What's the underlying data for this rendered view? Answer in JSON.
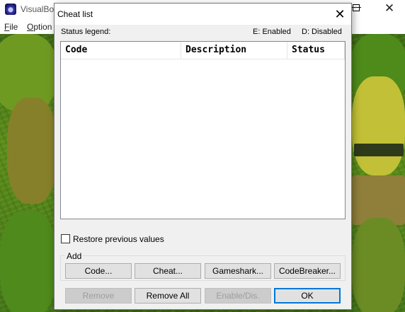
{
  "background_window": {
    "title": "VisualBo",
    "menu": [
      {
        "first": "F",
        "rest": "ile"
      },
      {
        "first": "O",
        "rest": "ption"
      }
    ],
    "minimize_glyph": "—",
    "close_glyph": "✕"
  },
  "dialog": {
    "title": "Cheat list",
    "close_glyph": "✕",
    "legend": {
      "label": "Status legend:",
      "enabled": "E: Enabled",
      "disabled": "D: Disabled"
    },
    "list": {
      "columns": [
        "Code",
        "Description",
        "Status"
      ],
      "rows": []
    },
    "restore_checkbox": {
      "label": "Restore previous values",
      "checked": false
    },
    "add_group": {
      "caption": "Add",
      "buttons": [
        "Code...",
        "Cheat...",
        "Gameshark...",
        "CodeBreaker..."
      ]
    },
    "bottom_buttons": {
      "remove": "Remove",
      "remove_all": "Remove All",
      "enable_dis": "Enable/Dis.",
      "ok": "OK"
    }
  },
  "colors": {
    "accent": "#0078d7",
    "dialog_bg": "#f0f0f0"
  }
}
